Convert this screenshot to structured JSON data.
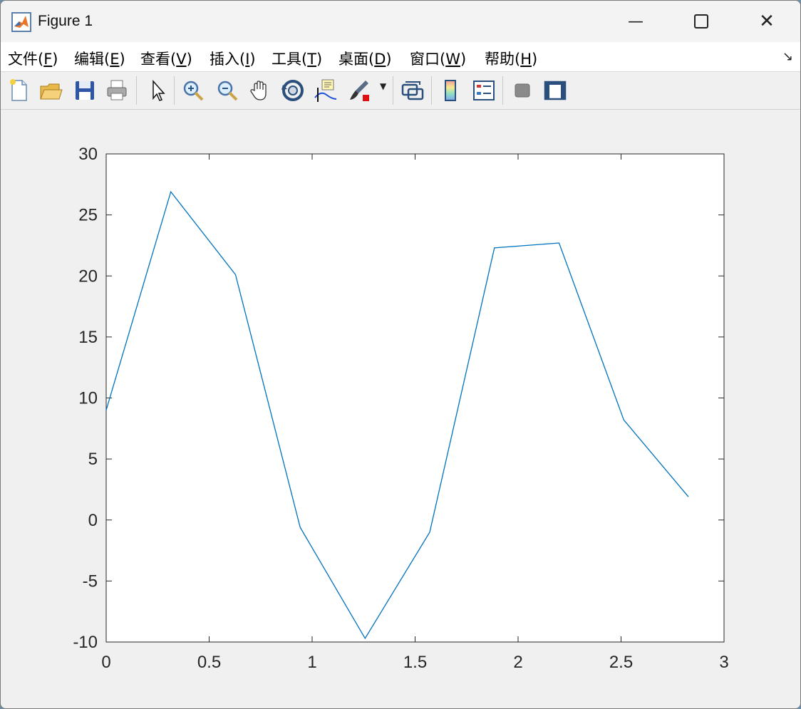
{
  "window": {
    "title": "Figure 1",
    "minimize_glyph": "—",
    "close_glyph": "✕"
  },
  "menu": [
    {
      "label": "文件(",
      "key": "F",
      "end": ")"
    },
    {
      "label": "编辑(",
      "key": "E",
      "end": ")"
    },
    {
      "label": "查看(",
      "key": "V",
      "end": ")"
    },
    {
      "label": "插入(",
      "key": "I",
      "end": ")"
    },
    {
      "label": "工具(",
      "key": "T",
      "end": ")"
    },
    {
      "label": "桌面(",
      "key": "D",
      "end": ")"
    },
    {
      "label": "窗口(",
      "key": "W",
      "end": ")"
    },
    {
      "label": "帮助(",
      "key": "H",
      "end": ")"
    }
  ],
  "menu_dock_glyph": "↘",
  "toolbar": [
    "new-figure-icon",
    "open-file-icon",
    "save-icon",
    "print-icon",
    "pointer-icon",
    "zoom-in-icon",
    "zoom-out-icon",
    "pan-hand-icon",
    "rotate-3d-icon",
    "data-cursor-icon",
    "brush-icon",
    "link-plot-icon",
    "colorbar-icon",
    "legend-icon",
    "hide-plot-tools-icon",
    "show-plot-tools-icon"
  ],
  "chart_data": {
    "type": "line",
    "title": "",
    "xlabel": "",
    "ylabel": "",
    "xlim": [
      0,
      3
    ],
    "ylim": [
      -10,
      30
    ],
    "xticks": [
      "0",
      "0.5",
      "1",
      "1.5",
      "2",
      "2.5",
      "3"
    ],
    "yticks": [
      "-10",
      "-5",
      "0",
      "5",
      "10",
      "15",
      "20",
      "25",
      "30"
    ],
    "grid": false,
    "line_color": "#0072BD",
    "series": [
      {
        "x": [
          0,
          0.314,
          0.628,
          0.942,
          1.257,
          1.571,
          1.885,
          2.199,
          2.513,
          2.827
        ],
        "y": [
          9.0,
          26.9,
          20.1,
          -0.6,
          -9.7,
          -1.0,
          22.3,
          22.7,
          8.2,
          1.9
        ]
      }
    ]
  }
}
